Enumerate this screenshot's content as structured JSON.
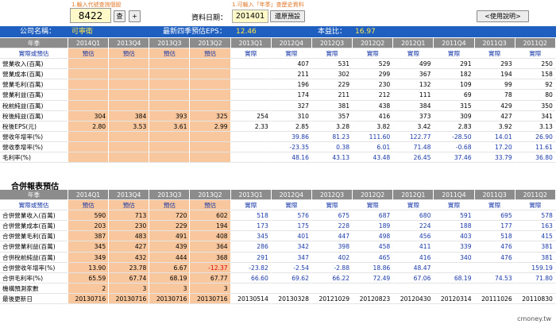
{
  "top": {
    "hint1": "1.輸入代號查詢個股",
    "hint2": "1.可輸入「年季」查歷史資料",
    "code_value": "8422",
    "query_btn": "查",
    "plus_btn": "+",
    "date_label": "資料日期：",
    "date_value": "201401",
    "restore_btn": "還原預設",
    "help_btn": "<使用說明>"
  },
  "band": {
    "name_label": "公司名稱：",
    "name_value": "可寧衛",
    "eps_label": "最新四季預估EPS：",
    "eps_value": "12.46",
    "pe_label": "本益比：",
    "pe_value": "16.97"
  },
  "table1": {
    "headers": [
      "年季",
      "2014Q1",
      "2013Q4",
      "2013Q3",
      "2013Q2",
      "2013Q1",
      "2012Q4",
      "2012Q3",
      "2012Q2",
      "2012Q1",
      "2011Q4",
      "2011Q3",
      "2011Q2"
    ],
    "sub": [
      "實際或預估",
      "預估",
      "預估",
      "預估",
      "預估",
      "實際",
      "實際",
      "實際",
      "實際",
      "實際",
      "實際",
      "實際",
      "實際"
    ],
    "rows": [
      {
        "label": "營業收入(百萬)",
        "cells": [
          "",
          "",
          "",
          "",
          "",
          "407",
          "531",
          "529",
          "499",
          "291",
          "293",
          "250"
        ]
      },
      {
        "label": "營業成本(百萬)",
        "cells": [
          "",
          "",
          "",
          "",
          "",
          "211",
          "302",
          "299",
          "367",
          "182",
          "194",
          "158"
        ]
      },
      {
        "label": "營業毛利(百萬)",
        "cells": [
          "",
          "",
          "",
          "",
          "",
          "196",
          "229",
          "230",
          "132",
          "109",
          "99",
          "92"
        ]
      },
      {
        "label": "營業利益(百萬)",
        "cells": [
          "",
          "",
          "",
          "",
          "",
          "174",
          "211",
          "212",
          "111",
          "69",
          "78",
          "80"
        ]
      },
      {
        "label": "稅前純益(百萬)",
        "cells": [
          "",
          "",
          "",
          "",
          "",
          "327",
          "381",
          "438",
          "384",
          "315",
          "429",
          "350"
        ]
      },
      {
        "label": "稅後純益(百萬)",
        "cells": [
          "304",
          "384",
          "393",
          "325",
          "254",
          "310",
          "357",
          "416",
          "373",
          "309",
          "427",
          "341"
        ]
      },
      {
        "label": "稅後EPS(元)",
        "cells": [
          "2.80",
          "3.53",
          "3.61",
          "2.99",
          "2.33",
          "2.85",
          "3.28",
          "3.82",
          "3.42",
          "2.83",
          "3.92",
          "3.13"
        ]
      }
    ],
    "rows2": [
      {
        "label": "營收年增率(%)",
        "cells": [
          "",
          "",
          "",
          "",
          "",
          "39.86",
          "81.23",
          "111.60",
          "122.77",
          "-28.50",
          "14.01",
          "26.90"
        ]
      },
      {
        "label": "營收季增率(%)",
        "cells": [
          "",
          "",
          "",
          "",
          "",
          "-23.35",
          "0.38",
          "6.01",
          "71.48",
          "-0.68",
          "17.20",
          "11.61"
        ]
      },
      {
        "label": "毛利率(%)",
        "cells": [
          "",
          "",
          "",
          "",
          "",
          "48.16",
          "43.13",
          "43.48",
          "26.45",
          "37.46",
          "33.79",
          "36.80"
        ]
      }
    ]
  },
  "section2_title": "合併報表預估",
  "table2": {
    "headers": [
      "年季",
      "2014Q1",
      "2013Q4",
      "2013Q3",
      "2013Q2",
      "2013Q1",
      "2012Q4",
      "2012Q3",
      "2012Q2",
      "2012Q1",
      "2011Q4",
      "2011Q3",
      "2011Q2"
    ],
    "sub": [
      "實際或預估",
      "預估",
      "預估",
      "預估",
      "預估",
      "實際",
      "實際",
      "實際",
      "實際",
      "實際",
      "實際",
      "實際",
      "實際"
    ],
    "rows": [
      {
        "label": "合併營業收入(百萬)",
        "cells": [
          "590",
          "713",
          "720",
          "602",
          "518",
          "576",
          "675",
          "687",
          "680",
          "591",
          "695",
          "578"
        ]
      },
      {
        "label": "合併營業成本(百萬)",
        "cells": [
          "203",
          "230",
          "229",
          "194",
          "173",
          "175",
          "228",
          "189",
          "224",
          "188",
          "177",
          "163"
        ]
      },
      {
        "label": "合併營業毛利(百萬)",
        "cells": [
          "387",
          "483",
          "491",
          "408",
          "345",
          "401",
          "447",
          "498",
          "456",
          "403",
          "518",
          "415"
        ]
      },
      {
        "label": "合併營業利益(百萬)",
        "cells": [
          "345",
          "427",
          "439",
          "364",
          "286",
          "342",
          "398",
          "458",
          "411",
          "339",
          "476",
          "381"
        ]
      },
      {
        "label": "合併稅前純益(百萬)",
        "cells": [
          "349",
          "432",
          "444",
          "368",
          "291",
          "347",
          "402",
          "465",
          "416",
          "340",
          "476",
          "381"
        ]
      }
    ],
    "rows2": [
      {
        "label": "合併營收年增率(%)",
        "cells": [
          "13.90",
          "23.78",
          "6.67",
          "-12.37",
          "-23.82",
          "-2.54",
          "-2.88",
          "18.86",
          "48.47",
          "",
          "",
          "159.19"
        ]
      },
      {
        "label": "合併毛利率(%)",
        "cells": [
          "65.59",
          "67.74",
          "68.19",
          "67.77",
          "66.60",
          "69.62",
          "66.22",
          "72.49",
          "67.06",
          "68.19",
          "74.53",
          "71.80"
        ]
      }
    ],
    "rows3": [
      {
        "label": "機構預測家數",
        "cells": [
          "2",
          "3",
          "3",
          "3",
          "",
          "",
          "",
          "",
          "",
          "",
          "",
          ""
        ]
      },
      {
        "label": "最後更新日",
        "cells": [
          "20130716",
          "20130716",
          "20130716",
          "20130716",
          "20130514",
          "20130328",
          "20121029",
          "20120823",
          "20120430",
          "20120314",
          "20111026",
          "20110830"
        ]
      }
    ]
  },
  "footer": "cmoney.tw",
  "colors": {
    "band": "#1f5fbf",
    "forecast": "#f9c79d",
    "header": "#8c8c8c",
    "negative": "#e00000",
    "value_blue": "#1a3aa8"
  }
}
